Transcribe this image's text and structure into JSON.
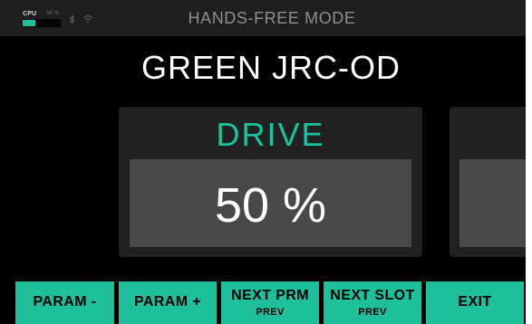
{
  "status_bar": {
    "cpu_label": "CPU",
    "cpu_percent_text": "34 %",
    "cpu_load": 0.34,
    "accent_color": "#1ebf9b",
    "icons": [
      "bluetooth-icon",
      "wifi-icon"
    ],
    "mode_title": "HANDS-FREE MODE"
  },
  "block": {
    "name": "GREEN JRC-OD"
  },
  "parameter": {
    "name": "DRIVE",
    "value": "50 %",
    "name_color": "#19c59e"
  },
  "softkeys": [
    {
      "label": "PARAM -",
      "sublabel": ""
    },
    {
      "label": "PARAM +",
      "sublabel": ""
    },
    {
      "label": "NEXT PRM",
      "sublabel": "PREV"
    },
    {
      "label": "NEXT SLOT",
      "sublabel": "PREV"
    },
    {
      "label": "EXIT",
      "sublabel": ""
    }
  ]
}
